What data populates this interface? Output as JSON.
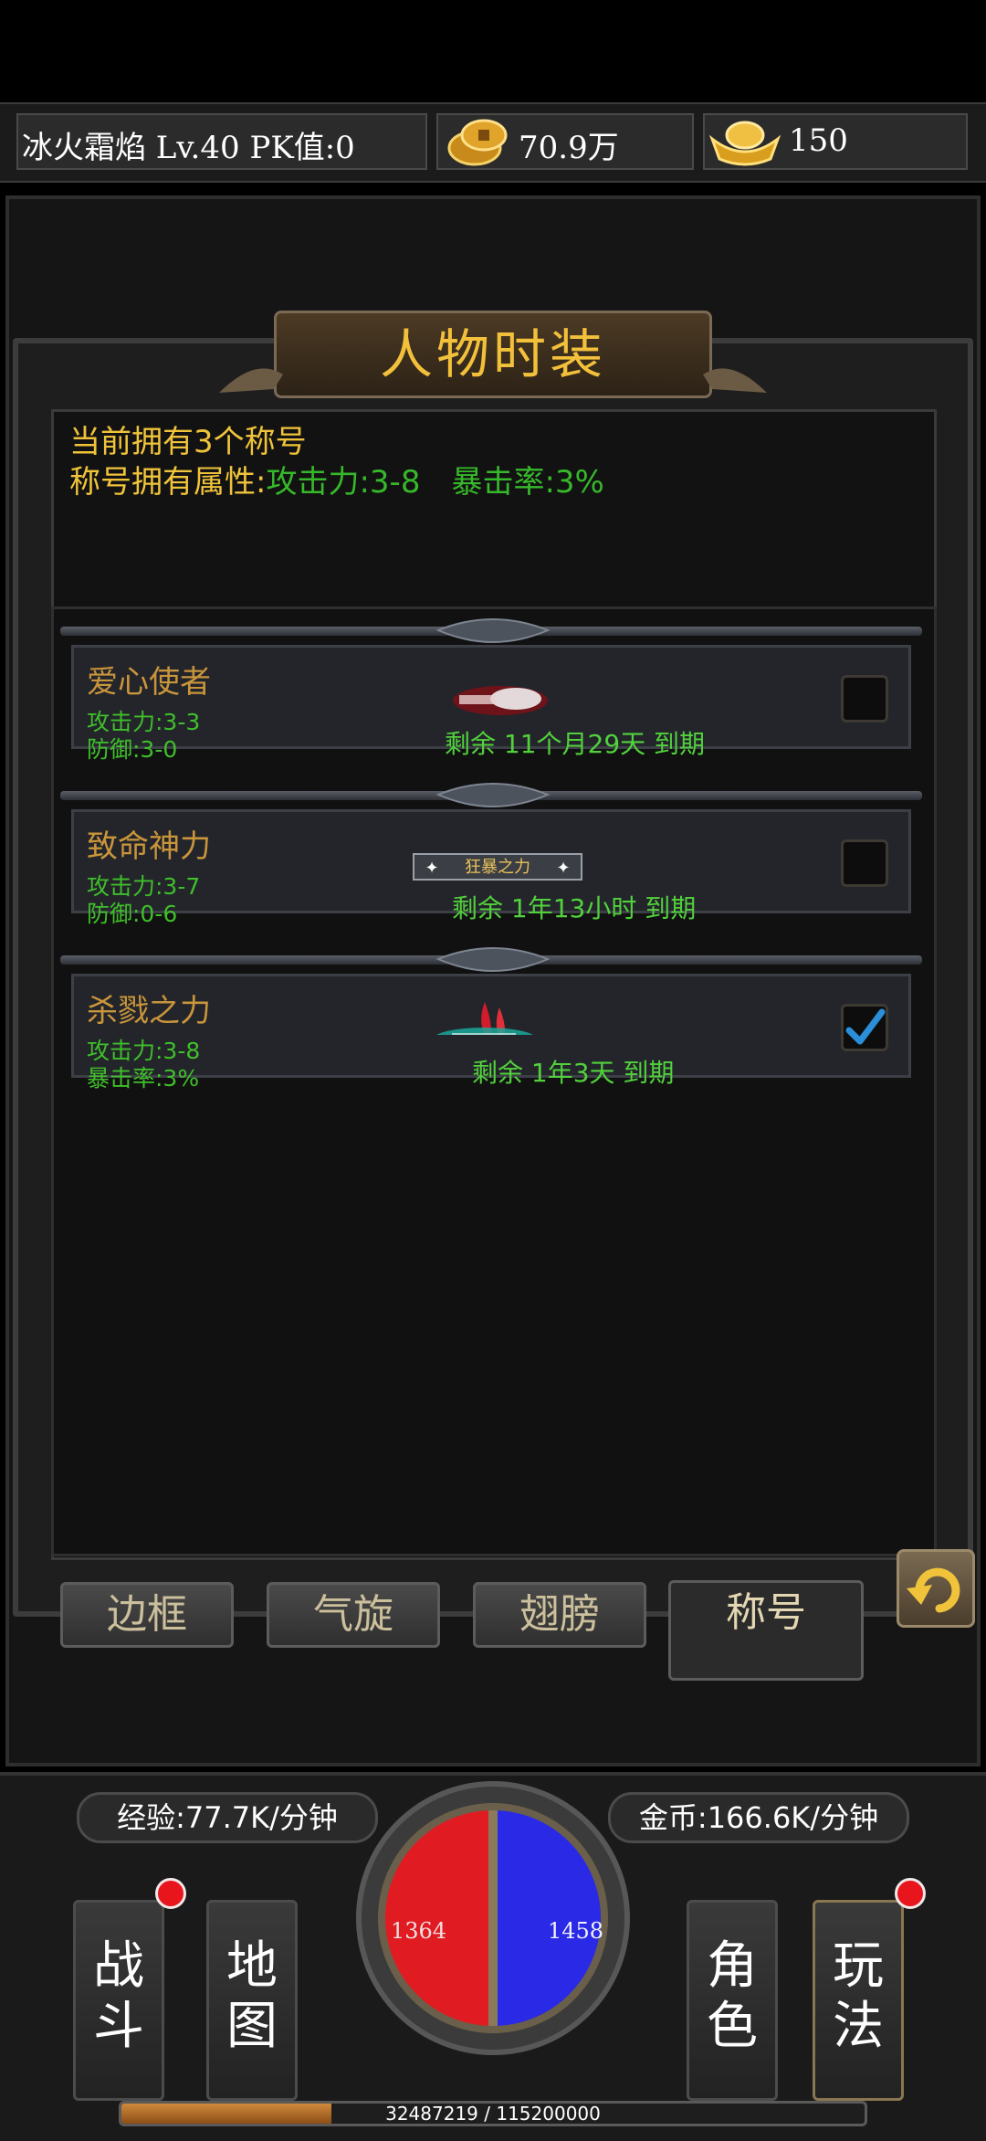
{
  "topbar": {
    "player_info": "冰火霜焰  Lv.40 PK值:0",
    "gold": "70.9万",
    "ingot": "150"
  },
  "panel": {
    "title": "人物时装",
    "summary_line1": "当前拥有3个称号",
    "summary_attr_label": "称号拥有属性:",
    "summary_attack": "攻击力:3-8",
    "summary_crit": "暴击率:3%"
  },
  "titles": [
    {
      "name": "爱心使者",
      "stat1": "攻击力:3-3",
      "stat2": "防御:3-0",
      "expiry": "剩余 11个月29天 到期",
      "badge_icon": "heart-envoy-badge-icon",
      "selected": false
    },
    {
      "name": "致命神力",
      "stat1": "攻击力:3-7",
      "stat2": "防御:0-6",
      "expiry": "剩余 1年13小时 到期",
      "badge_icon": "frenzy-power-badge-icon",
      "badge_text": "狂暴之力",
      "selected": false
    },
    {
      "name": "杀戮之力",
      "stat1": "攻击力:3-8",
      "stat2": "暴击率:3%",
      "expiry": "剩余 1年3天 到期",
      "badge_icon": "slaughter-power-badge-icon",
      "selected": true
    }
  ],
  "tabs": [
    {
      "label": "边框",
      "active": false
    },
    {
      "label": "气旋",
      "active": false
    },
    {
      "label": "翅膀",
      "active": false
    },
    {
      "label": "称号",
      "active": true
    }
  ],
  "hud": {
    "exp_rate": "经验:77.7K/分钟",
    "gold_rate": "金币:166.6K/分钟",
    "hp": "1364",
    "mp": "1458",
    "xp_text": "32487219 / 115200000",
    "xp_fraction": 0.282,
    "menu": [
      {
        "label": "战\n斗",
        "notify": true
      },
      {
        "label": "地\n图",
        "notify": false
      },
      {
        "label": "角\n色",
        "notify": false
      },
      {
        "label": "玩\n法",
        "notify": true
      }
    ]
  },
  "colors": {
    "gold_text": "#f0c33b",
    "green_text": "#36b82a",
    "title_name": "#c9953b",
    "hp_red": "#e02020",
    "mp_blue": "#2a2ae0"
  }
}
